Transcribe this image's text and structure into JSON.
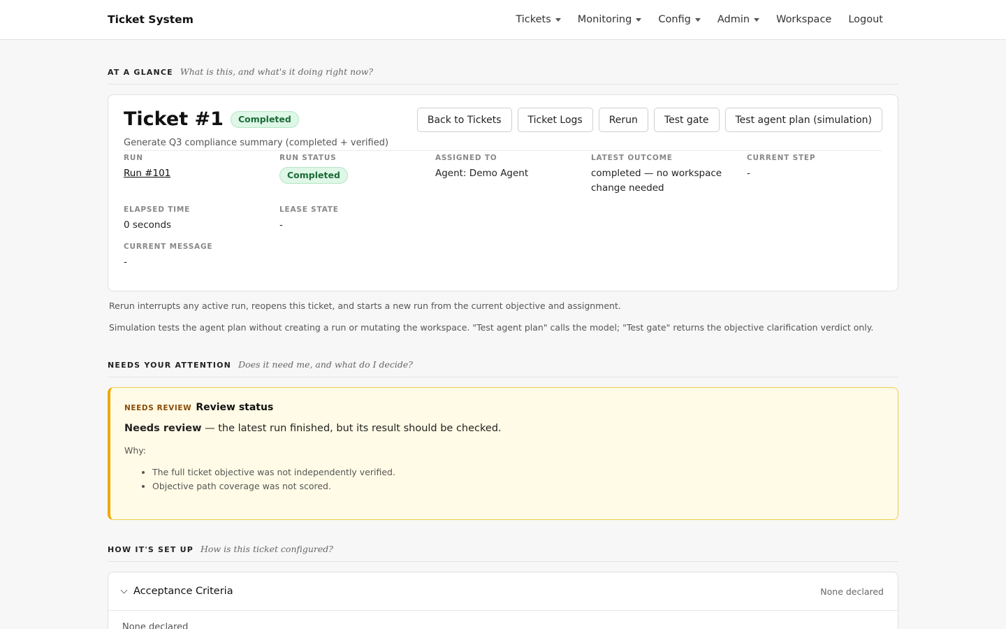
{
  "nav": {
    "brand": "Ticket System",
    "links": [
      {
        "label": "Tickets",
        "dropdown": true
      },
      {
        "label": "Monitoring",
        "dropdown": true
      },
      {
        "label": "Config",
        "dropdown": true
      },
      {
        "label": "Admin",
        "dropdown": true
      },
      {
        "label": "Workspace",
        "dropdown": false
      },
      {
        "label": "Logout",
        "dropdown": false
      }
    ]
  },
  "glance": {
    "title": "AT A GLANCE",
    "subtitle": "What is this, and what's it doing right now?"
  },
  "ticket": {
    "title": "Ticket #1",
    "status": "Completed",
    "description": "Generate Q3 compliance summary (completed + verified)",
    "actions": {
      "back": "Back to Tickets",
      "logs": "Ticket Logs",
      "rerun": "Rerun",
      "test_gate": "Test gate",
      "test_plan": "Test agent plan (simulation)"
    },
    "fields": {
      "run_label": "RUN",
      "run_value": "Run #101",
      "run_status_label": "RUN STATUS",
      "run_status_value": "Completed",
      "assigned_label": "ASSIGNED TO",
      "assigned_value": "Agent: Demo Agent",
      "outcome_label": "LATEST OUTCOME",
      "outcome_value": "completed — no workspace change needed",
      "step_label": "CURRENT STEP",
      "step_value": "-",
      "elapsed_label": "ELAPSED TIME",
      "elapsed_value": "0 seconds",
      "lease_label": "LEASE STATE",
      "lease_value": "-",
      "message_label": "CURRENT MESSAGE",
      "message_value": "-"
    }
  },
  "notes": {
    "rerun": "Rerun interrupts any active run, reopens this ticket, and starts a new run from the current objective and assignment.",
    "simulation": "Simulation tests the agent plan without creating a run or mutating the workspace. \"Test agent plan\" calls the model; \"Test gate\" returns the objective clarification verdict only."
  },
  "attention_section": {
    "title": "NEEDS YOUR ATTENTION",
    "subtitle": "Does it need me, and what do I decide?"
  },
  "review": {
    "tag": "NEEDS REVIEW",
    "title": "Review status",
    "summary_bold": "Needs review",
    "summary_rest": " — the latest run finished, but its result should be checked.",
    "why_label": "Why:",
    "reasons": [
      "The full ticket objective was not independently verified.",
      "Objective path coverage was not scored."
    ]
  },
  "setup_section": {
    "title": "HOW IT'S SET UP",
    "subtitle": "How is this ticket configured?"
  },
  "acceptance": {
    "title": "Acceptance Criteria",
    "meta": "None declared",
    "body": "None declared"
  }
}
